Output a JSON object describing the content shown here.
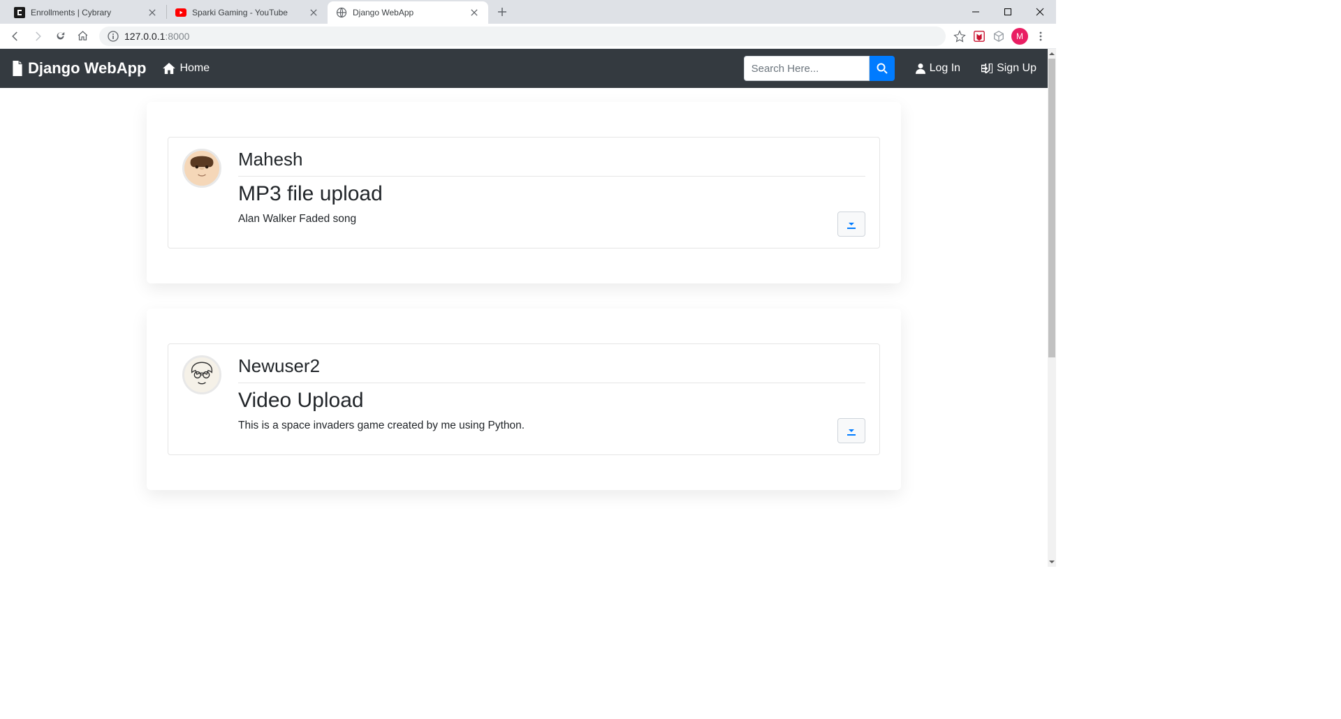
{
  "browser": {
    "tabs": [
      {
        "title": "Enrollments | Cybrary",
        "favicon_bg": "#1a1a1a"
      },
      {
        "title": "Sparki Gaming - YouTube",
        "favicon_bg": "#ff0000"
      },
      {
        "title": "Django WebApp",
        "favicon_bg": "#9aa0a6"
      }
    ],
    "active_tab": 2,
    "url_host": "127.0.0.1",
    "url_port": ":8000",
    "profile_letter": "M"
  },
  "navbar": {
    "brand": "Django WebApp",
    "home": "Home",
    "search_placeholder": "Search Here...",
    "login": "Log In",
    "signup": "Sign Up"
  },
  "posts": [
    {
      "author": "Mahesh",
      "title": "MP3 file upload",
      "description": "Alan Walker Faded song",
      "avatar_style": "cartoon-male"
    },
    {
      "author": "Newuser2",
      "title": "Video Upload",
      "description": "This is a space invaders game created by me using Python.",
      "avatar_style": "sketch-face"
    }
  ]
}
